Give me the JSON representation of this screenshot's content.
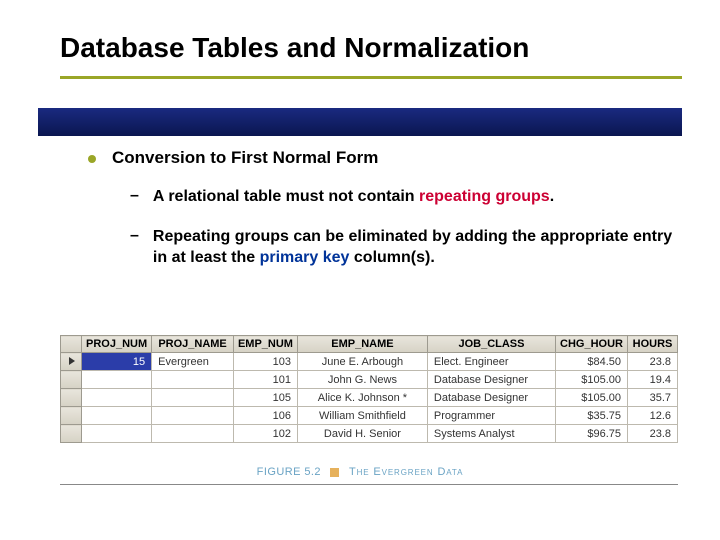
{
  "title": "Database Tables and Normalization",
  "bullet": "Conversion to First Normal Form",
  "sub1_a": "A relational table must not contain ",
  "sub1_b": "repeating groups",
  "sub1_c": ".",
  "sub2_a": "Repeating groups can be eliminated by adding the appropriate entry in at least the ",
  "sub2_b": "primary key",
  "sub2_c": " column(s).",
  "cols": {
    "proj_num": "PROJ_NUM",
    "proj_name": "PROJ_NAME",
    "emp_num": "EMP_NUM",
    "emp_name": "EMP_NAME",
    "job_class": "JOB_CLASS",
    "chg_hour": "CHG_HOUR",
    "hours": "HOURS"
  },
  "rows": [
    {
      "proj_num": "15",
      "proj_name": "Evergreen",
      "emp_num": "103",
      "emp_name": "June E. Arbough",
      "job_class": "Elect. Engineer",
      "chg_hour": "$84.50",
      "hours": "23.8",
      "sel": true
    },
    {
      "proj_num": "",
      "proj_name": "",
      "emp_num": "101",
      "emp_name": "John G. News",
      "job_class": "Database Designer",
      "chg_hour": "$105.00",
      "hours": "19.4"
    },
    {
      "proj_num": "",
      "proj_name": "",
      "emp_num": "105",
      "emp_name": "Alice K. Johnson *",
      "job_class": "Database Designer",
      "chg_hour": "$105.00",
      "hours": "35.7"
    },
    {
      "proj_num": "",
      "proj_name": "",
      "emp_num": "106",
      "emp_name": "William Smithfield",
      "job_class": "Programmer",
      "chg_hour": "$35.75",
      "hours": "12.6"
    },
    {
      "proj_num": "",
      "proj_name": "",
      "emp_num": "102",
      "emp_name": "David H. Senior",
      "job_class": "Systems Analyst",
      "chg_hour": "$96.75",
      "hours": "23.8"
    }
  ],
  "figure_no": "FIGURE 5.2",
  "figure_txt": "The Evergreen Data"
}
